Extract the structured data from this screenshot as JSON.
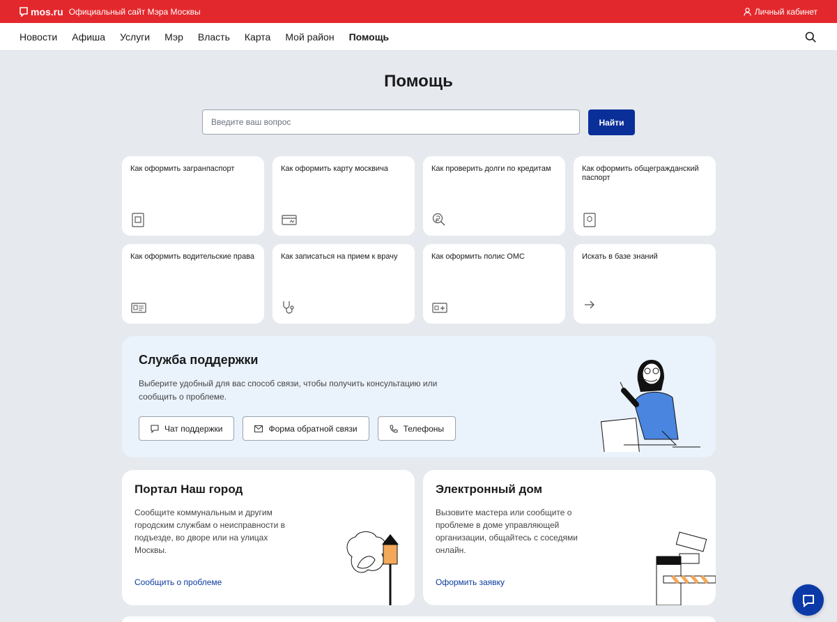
{
  "header": {
    "logo_text": "mos.ru",
    "slogan": "Официальный сайт Мэра Москвы",
    "cabinet": "Личный кабинет"
  },
  "nav": {
    "items": [
      "Новости",
      "Афиша",
      "Услуги",
      "Мэр",
      "Власть",
      "Карта",
      "Мой район",
      "Помощь"
    ],
    "active": "Помощь"
  },
  "page": {
    "title": "Помощь",
    "search_placeholder": "Введите ваш вопрос",
    "search_button": "Найти"
  },
  "cards": [
    {
      "label": "Как оформить загранпаспорт",
      "icon": "passport-icon"
    },
    {
      "label": "Как оформить карту москвича",
      "icon": "card-icon"
    },
    {
      "label": "Как проверить долги по кредитам",
      "icon": "debt-search-icon"
    },
    {
      "label": "Как оформить общегражданский паспорт",
      "icon": "emblem-passport-icon"
    },
    {
      "label": "Как оформить водительские права",
      "icon": "driver-license-icon"
    },
    {
      "label": "Как записаться на прием к врачу",
      "icon": "stethoscope-icon"
    },
    {
      "label": "Как оформить полис ОМС",
      "icon": "insurance-card-icon"
    },
    {
      "label": "Искать в базе знаний",
      "icon": "arrow-right-icon"
    }
  ],
  "support": {
    "title": "Служба поддержки",
    "text": "Выберите удобный для вас способ связи, чтобы получить консультацию или сообщить о проблеме.",
    "buttons": [
      "Чат поддержки",
      "Форма обратной связи",
      "Телефоны"
    ]
  },
  "portal": {
    "title": "Портал Наш город",
    "text": "Сообщите коммунальным и другим городским службам о неисправности в подъезде, во дворе или на улицах Москвы.",
    "link": "Сообщить о проблеме"
  },
  "edom": {
    "title": "Электронный дом",
    "text": "Вызовите мастера или сообщите о проблеме в доме управляющей организации, общайтесь с соседями онлайн.",
    "link": "Оформить заявку"
  },
  "colors": {
    "brand_red": "#e3282d",
    "primary_blue": "#0b2f99",
    "support_bg": "#eaf2fb"
  }
}
